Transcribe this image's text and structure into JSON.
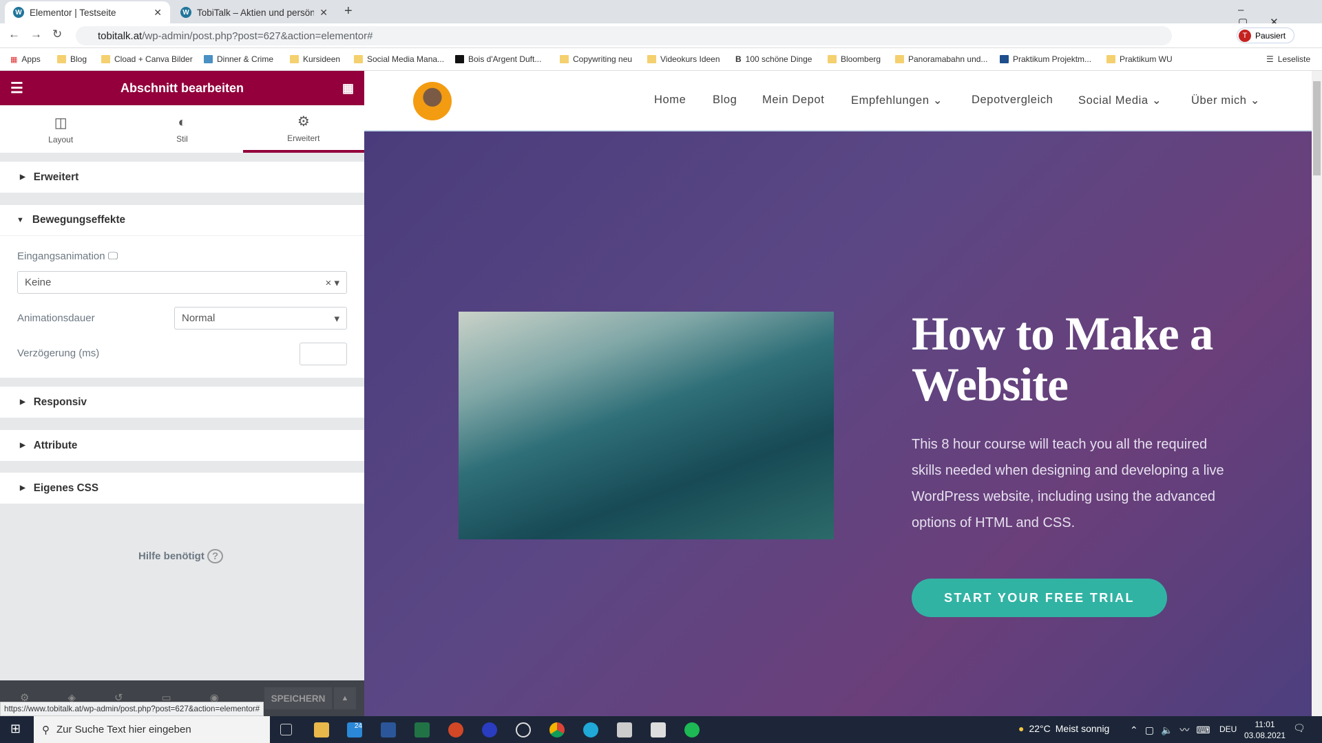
{
  "browser": {
    "tabs": [
      {
        "title": "Elementor | Testseite",
        "active": true
      },
      {
        "title": "TobiTalk – Aktien und persönliche"
      }
    ],
    "url_host": "tobitalk.at",
    "url_path": "/wp-admin/post.php?post=627&action=elementor#",
    "profile_label": "Pausiert",
    "bookmarks": [
      "Apps",
      "Blog",
      "Cload + Canva Bilder",
      "Dinner & Crime",
      "Kursideen",
      "Social Media Mana...",
      "Bois d'Argent Duft...",
      "Copywriting neu",
      "Videokurs Ideen",
      "100 schöne Dinge",
      "Bloomberg",
      "Panoramabahn und...",
      "Praktikum Projektm...",
      "Praktikum WU"
    ],
    "reading_list": "Leseliste"
  },
  "panel": {
    "title": "Abschnitt bearbeiten",
    "tabs": [
      {
        "label": "Layout",
        "icon": "layout-icon"
      },
      {
        "label": "Stil",
        "icon": "contrast-icon"
      },
      {
        "label": "Erweitert",
        "icon": "gear-icon",
        "active": true
      }
    ],
    "sections": {
      "erweitert": "Erweitert",
      "bewegung": "Bewegungseffekte",
      "responsiv": "Responsiv",
      "attribute": "Attribute",
      "css": "Eigenes CSS"
    },
    "fields": {
      "entrance_label": "Eingangsanimation",
      "entrance_value": "Keine",
      "duration_label": "Animationsdauer",
      "duration_value": "Normal",
      "delay_label": "Verzögerung (ms)",
      "delay_value": ""
    },
    "help": "Hilfe benötigt",
    "save": "SPEICHERN"
  },
  "status_url": "https://www.tobitalk.at/wp-admin/post.php?post=627&action=elementor#",
  "site": {
    "nav": [
      "Home",
      "Blog",
      "Mein Depot",
      "Empfehlungen",
      "Depotvergleich",
      "Social Media",
      "Über mich"
    ],
    "hero_title": "How to Make a Website",
    "hero_desc": "This 8 hour course will teach you all the required skills needed when designing and developing a live WordPress website, including using the advanced options of HTML and CSS.",
    "cta": "START YOUR FREE TRIAL",
    "cta_color": "#31b3a4"
  },
  "taskbar": {
    "search": "Zur Suche Text hier eingeben",
    "mail_badge": "24",
    "weather": "22°C",
    "weather_text": "Meist sonnig",
    "lang": "DEU",
    "time": "11:01",
    "date": "03.08.2021"
  }
}
